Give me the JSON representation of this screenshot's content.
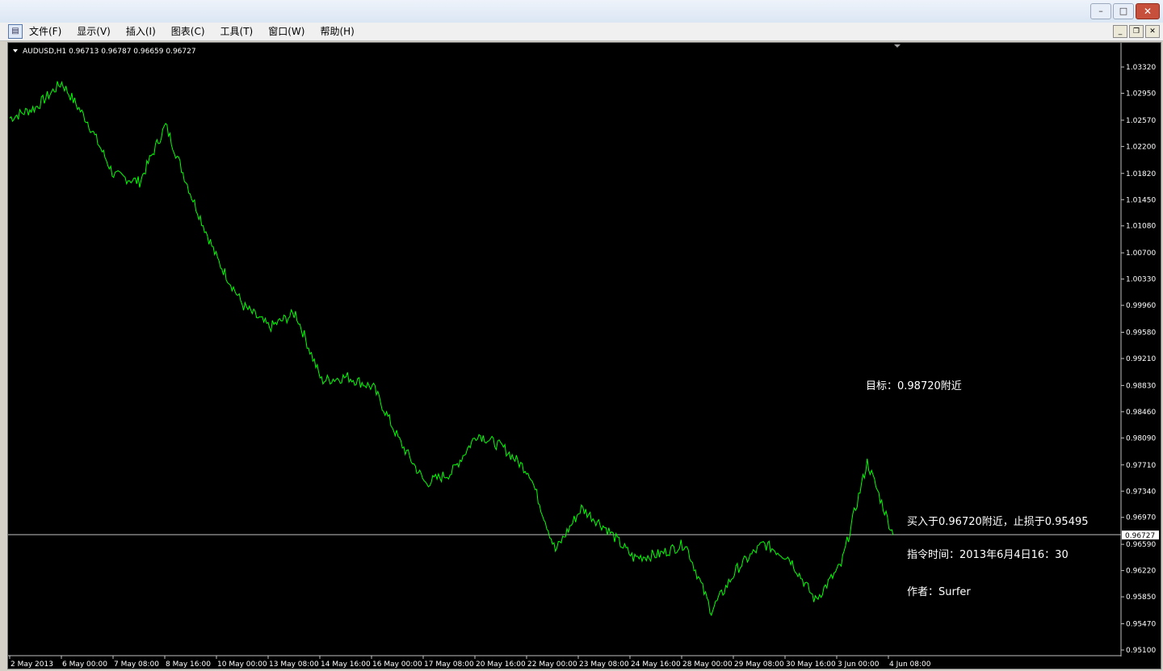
{
  "window": {
    "min_label": "–",
    "max_label": "□",
    "close_label": "✕"
  },
  "menu": {
    "app_icon": "chart-app-icon",
    "items": [
      "文件(F)",
      "显示(V)",
      "插入(I)",
      "图表(C)",
      "工具(T)",
      "窗口(W)",
      "帮助(H)"
    ],
    "mdi_min": "_",
    "mdi_restore": "❐",
    "mdi_close": "✕"
  },
  "chart": {
    "header": "AUDUSD,H1  0.96713 0.96787 0.96659 0.96727",
    "current_price": "0.96727",
    "price_labels": [
      "1.03320",
      "1.02950",
      "1.02570",
      "1.02200",
      "1.01820",
      "1.01450",
      "1.01080",
      "1.00700",
      "1.00330",
      "0.99960",
      "0.99580",
      "0.99210",
      "0.98830",
      "0.98460",
      "0.98090",
      "0.97710",
      "0.97340",
      "0.96970",
      "0.96590",
      "0.96220",
      "0.95850",
      "0.95470",
      "0.95100"
    ],
    "time_labels": [
      "2 May 2013",
      "6 May 00:00",
      "7 May 08:00",
      "8 May 16:00",
      "10 May 00:00",
      "13 May 08:00",
      "14 May 16:00",
      "16 May 00:00",
      "17 May 08:00",
      "20 May 16:00",
      "22 May 00:00",
      "23 May 08:00",
      "24 May 16:00",
      "28 May 00:00",
      "29 May 08:00",
      "30 May 16:00",
      "3 Jun 00:00",
      "4 Jun 08:00"
    ],
    "annotations": {
      "target": "目标：0.98720附近",
      "buy": "买入于0.96720附近，止损于0.95495",
      "time": "指令时间：2013年6月4日16：30",
      "author": "作者：Surfer"
    },
    "colors": {
      "line": "#00ff00",
      "background": "#000000",
      "text": "#ffffff",
      "hline": "#c0c0c0"
    }
  },
  "chart_data": {
    "type": "line",
    "title": "AUDUSD,H1",
    "ylim": [
      0.951,
      1.0332
    ],
    "x": [
      "2 May 2013",
      "3 May",
      "6 May 00:00",
      "6 May",
      "7 May 08:00",
      "7 May",
      "8 May 16:00",
      "9 May",
      "10 May 00:00",
      "10 May",
      "13 May 08:00",
      "13 May",
      "14 May 16:00",
      "15 May",
      "16 May 00:00",
      "16 May",
      "17 May 08:00",
      "17 May",
      "20 May 16:00",
      "21 May",
      "22 May 00:00",
      "22 May",
      "23 May 08:00",
      "23 May",
      "24 May 16:00",
      "27 May",
      "28 May 00:00",
      "28 May",
      "29 May 08:00",
      "29 May",
      "30 May 16:00",
      "31 May",
      "3 Jun 00:00",
      "3 Jun",
      "4 Jun 08:00"
    ],
    "series": [
      {
        "values": [
          1.026,
          1.0275,
          1.031,
          1.0255,
          1.018,
          1.017,
          1.025,
          1.015,
          1.006,
          0.9995,
          0.9965,
          0.9985,
          0.989,
          0.9895,
          0.988,
          0.9805,
          0.9745,
          0.976,
          0.9815,
          0.9795,
          0.976,
          0.965,
          0.971,
          0.968,
          0.964,
          0.9645,
          0.966,
          0.9565,
          0.9625,
          0.966,
          0.964,
          0.958,
          0.963,
          0.9775,
          0.9672
        ]
      }
    ]
  }
}
